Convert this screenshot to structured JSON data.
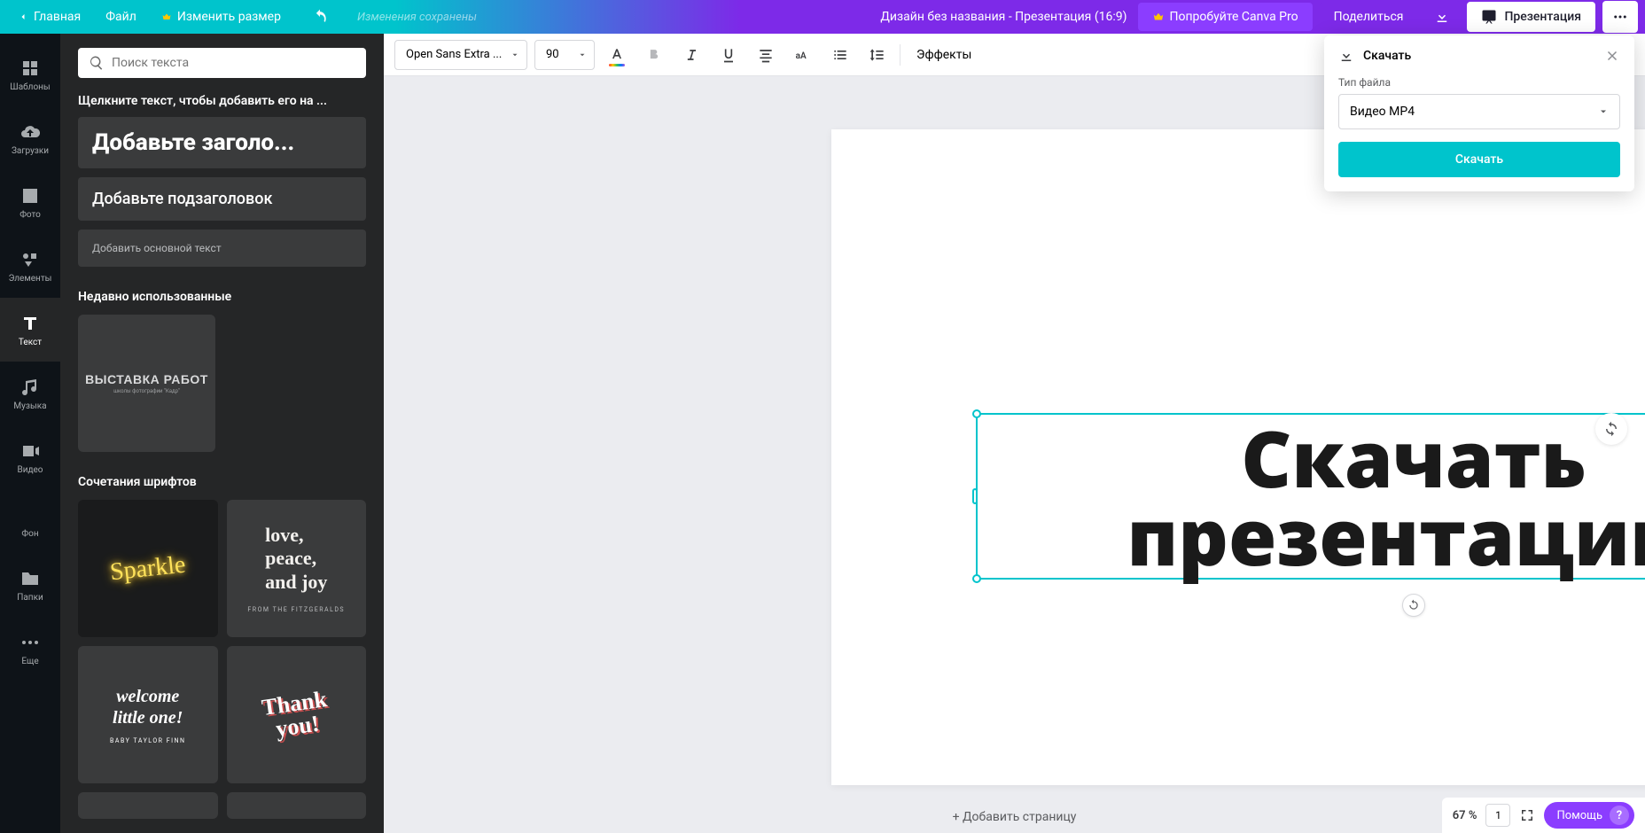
{
  "topbar": {
    "home": "Главная",
    "file": "Файл",
    "resize": "Изменить размер",
    "status": "Изменения сохранены",
    "title": "Дизайн без названия - Презентация (16:9)",
    "try_pro": "Попробуйте Canva Pro",
    "share": "Поделиться",
    "present": "Презентация"
  },
  "rail": {
    "templates": "Шаблоны",
    "uploads": "Загрузки",
    "photos": "Фото",
    "elements": "Элементы",
    "text": "Текст",
    "music": "Музыка",
    "video": "Видео",
    "background": "Фон",
    "folders": "Папки",
    "more": "Еще"
  },
  "side": {
    "search_placeholder": "Поиск текста",
    "click_hint": "Щелкните текст, чтобы добавить его на ...",
    "add_heading": "Добавьте заголо...",
    "add_subheading": "Добавьте подзаголовок",
    "add_body": "Добавить основной текст",
    "recent_title": "Недавно использованные",
    "recent_tile_t1": "ВЫСТАВКА РАБОТ",
    "recent_tile_t2": "школы фотографии \"Кадр\"",
    "combos_title": "Сочетания шрифтов",
    "sparkle": "Sparkle",
    "love_lines": "love,\npeace,\nand joy",
    "love_sub": "FROM THE FITZGERALDS",
    "welcome_lines": "welcome\nlittle one!",
    "welcome_sub": "BABY TAYLOR FINN",
    "thank": "Thank\nyou!"
  },
  "toolbar": {
    "font": "Open Sans Extra ...",
    "size": "90",
    "effects": "Эффекты"
  },
  "canvas": {
    "text": "Скачать презентацию",
    "add_page": "+ Добавить страницу"
  },
  "popover": {
    "title": "Скачать",
    "file_type_label": "Тип файла",
    "file_type_value": "Видео MP4",
    "download": "Скачать"
  },
  "status": {
    "zoom": "67 %",
    "page": "1",
    "help": "Помощь",
    "q": "?"
  }
}
